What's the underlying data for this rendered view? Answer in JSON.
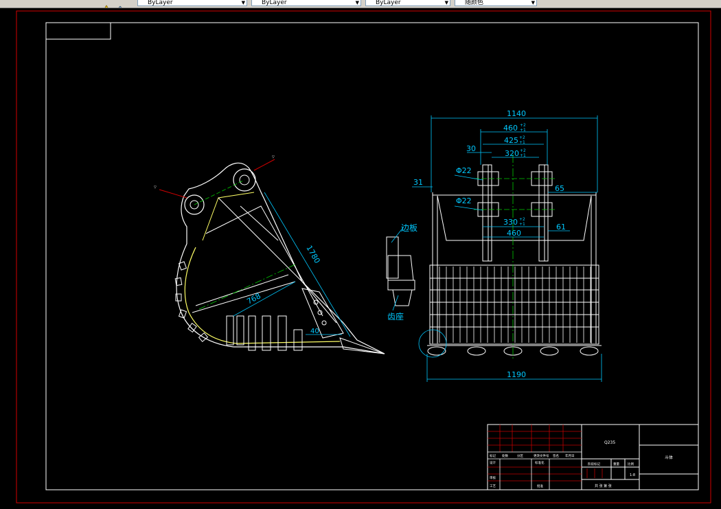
{
  "toolbar": {
    "layer_icon": "layer-icon",
    "combos": [
      {
        "value": "ByLayer"
      },
      {
        "value": "ByLayer"
      },
      {
        "value": "ByLayer"
      },
      {
        "value": "随颜色"
      }
    ]
  },
  "drawing": {
    "side_view": {
      "dim_length": "1780",
      "dim_inner": "768",
      "dim_tip": "40",
      "callout_edge_plate": "边板",
      "callout_tooth_seat": "齿座"
    },
    "front_view": {
      "dim_total_width": "1140",
      "dim_460_tol": "460+2/+1",
      "dim_460": "460",
      "dim_425": "425",
      "dim_320": "320",
      "dim_30": "30",
      "dim_31": "31",
      "dim_65": "65",
      "dim_phi22_top": "Φ22",
      "dim_phi22_bottom": "Φ22",
      "dim_330": "330",
      "dim_61": "61",
      "dim_460_lower": "460",
      "dim_bottom_width": "1190",
      "tol_upper": "+2",
      "tol_lower": "+1"
    },
    "title_block": {
      "material": "Q235",
      "part_name": "斗体",
      "scale": "1:8",
      "sheet_label": "共 张 第 张",
      "row_labels": [
        "标记",
        "处数",
        "分区",
        "更改文件号",
        "签名",
        "年月日"
      ],
      "design": "设计",
      "standardize": "标准化",
      "stage_mark": "阶段标记",
      "weight": "重量",
      "scale_label": "比例",
      "review": "审核",
      "process": "工艺",
      "approve": "批准"
    }
  },
  "colors": {
    "border_red": "#d40000",
    "frame_white": "#ffffff",
    "dim_cyan": "#00c8ff",
    "center_green": "#00cc00",
    "outline_yellow": "#ffff66",
    "title_red": "#c00000"
  }
}
